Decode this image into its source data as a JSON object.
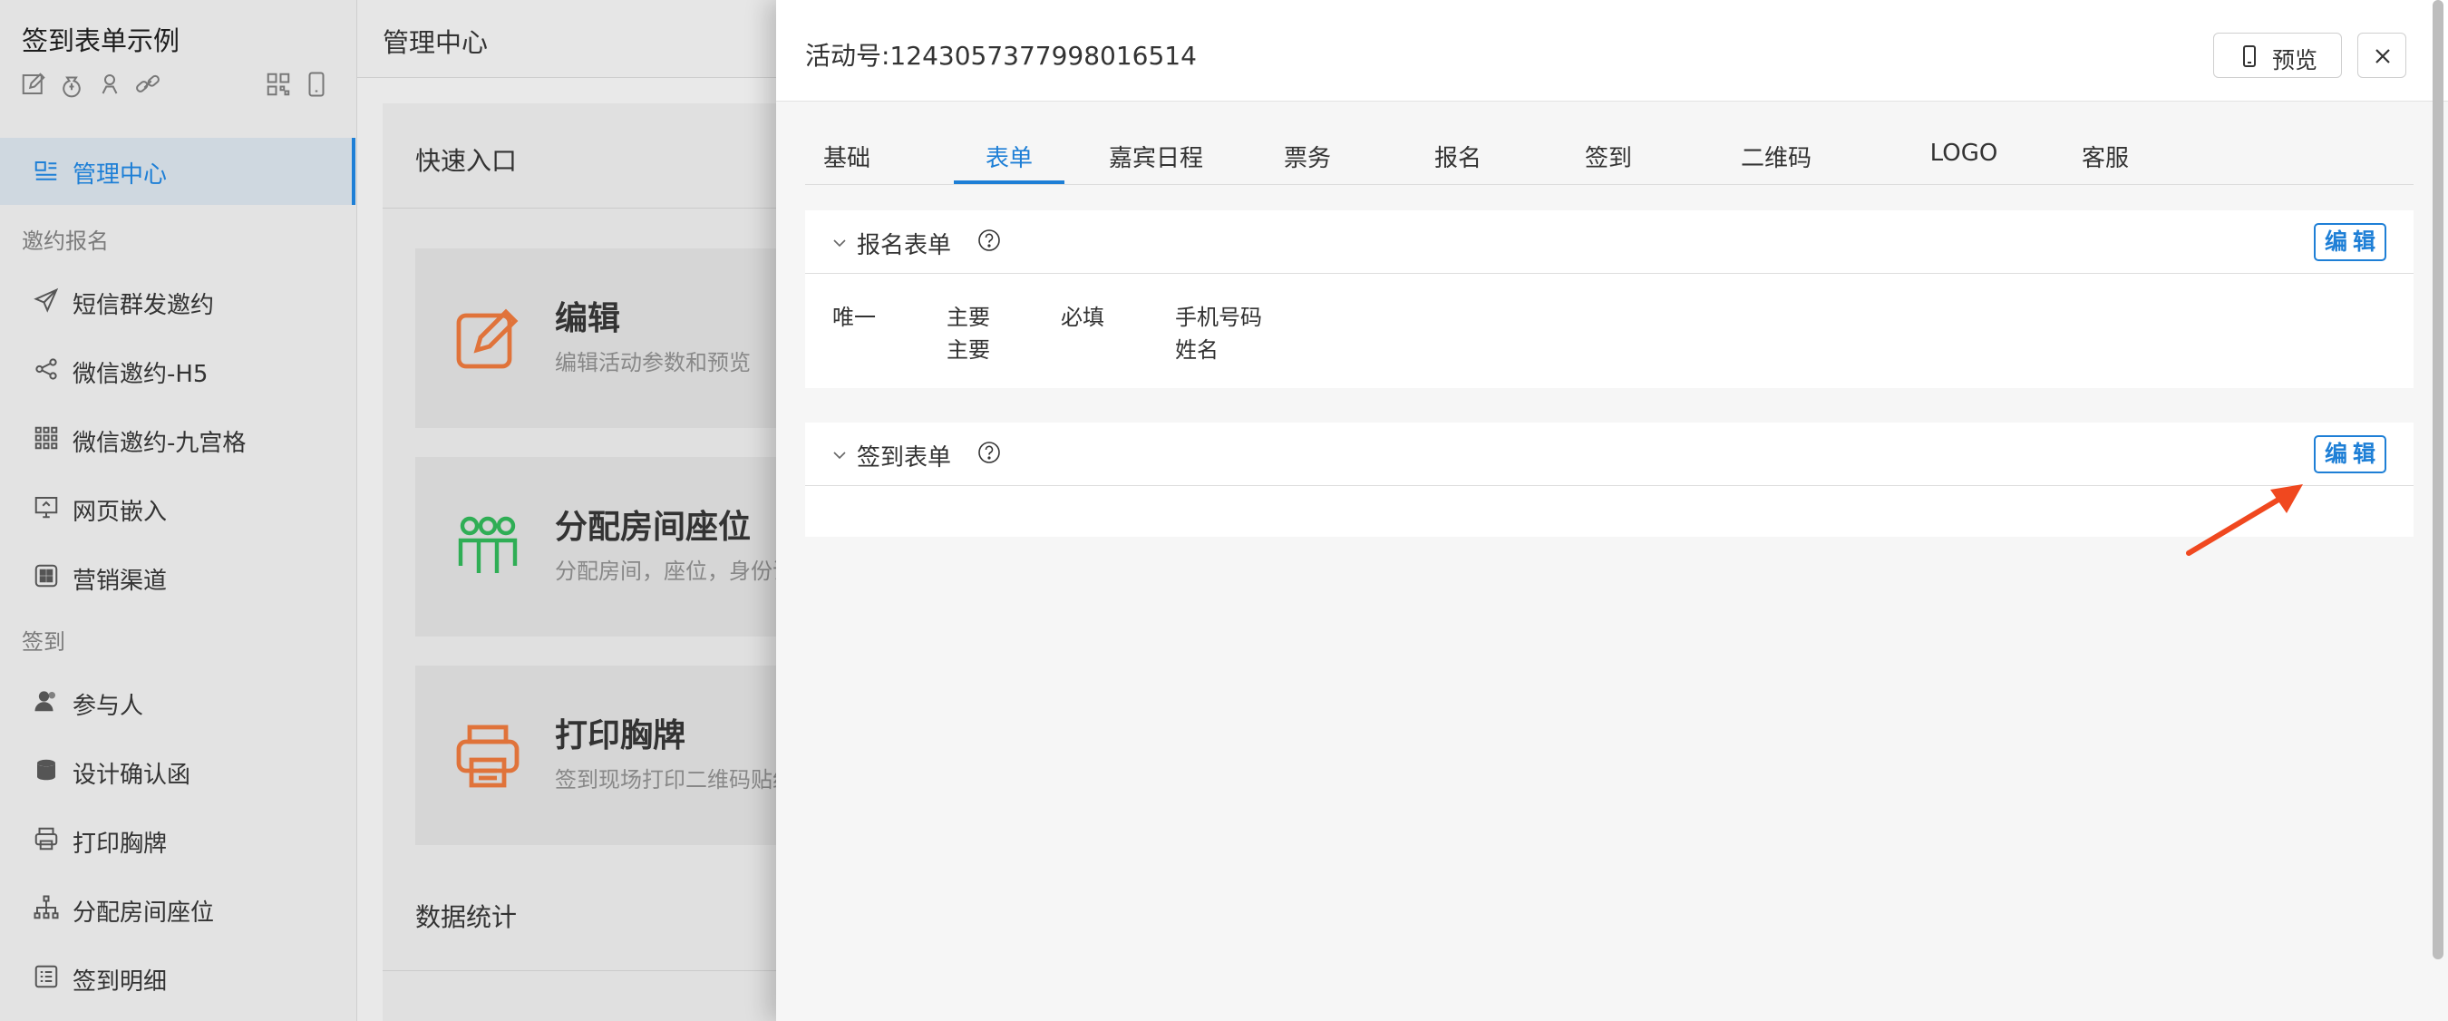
{
  "sidebar": {
    "app_title": "签到表单示例",
    "tool_icons": [
      "edit-icon",
      "money-bag-icon",
      "person-icon",
      "link-icon",
      "qrcode-icon",
      "mobile-icon"
    ],
    "active_item": {
      "label": "管理中心",
      "icon": "dashboard-icon"
    },
    "groups": [
      {
        "label": "邀约报名",
        "items": [
          {
            "label": "短信群发邀约",
            "icon": "send-icon"
          },
          {
            "label": "微信邀约-H5",
            "icon": "share-icon"
          },
          {
            "label": "微信邀约-九宫格",
            "icon": "grid-icon"
          },
          {
            "label": "网页嵌入",
            "icon": "monitor-icon"
          },
          {
            "label": "营销渠道",
            "icon": "apps-icon"
          }
        ]
      },
      {
        "label": "签到",
        "items": [
          {
            "label": "参与人",
            "icon": "users-icon"
          },
          {
            "label": "设计确认函",
            "icon": "database-icon"
          },
          {
            "label": "打印胸牌",
            "icon": "printer-icon"
          },
          {
            "label": "分配房间座位",
            "icon": "org-chart-icon"
          },
          {
            "label": "签到明细",
            "icon": "list-icon"
          }
        ]
      }
    ]
  },
  "main": {
    "header_title": "管理中心",
    "quick_entry_title": "快速入口",
    "cards": [
      {
        "title": "编辑",
        "desc": "编辑活动参数和预览",
        "icon": "edit-icon",
        "color": "#e0733a"
      },
      {
        "title": "分配房间座位",
        "desc": "分配房间，座位，身份证",
        "icon": "team-icon",
        "color": "#2fae55"
      },
      {
        "title": "打印胸牌",
        "desc": "签到现场打印二维码贴纸",
        "icon": "printer-icon",
        "color": "#e0733a"
      }
    ],
    "stats_title": "数据统计"
  },
  "drawer": {
    "title": "活动号:1243057377998016514",
    "preview_label": "预览",
    "tabs": [
      "基础",
      "表单",
      "嘉宾日程",
      "票务",
      "报名",
      "签到",
      "二维码",
      "LOGO",
      "客服"
    ],
    "active_tab": "表单",
    "sections": [
      {
        "title": "报名表单",
        "edit_label": "编辑",
        "columns": [
          {
            "lines": [
              "唯一"
            ]
          },
          {
            "lines": [
              "主要",
              "主要"
            ]
          },
          {
            "lines": [
              "必填"
            ]
          },
          {
            "lines": [
              "手机号码",
              "姓名"
            ]
          }
        ]
      },
      {
        "title": "签到表单",
        "edit_label": "编辑",
        "columns": []
      }
    ]
  },
  "colors": {
    "accent": "#1e7fd6",
    "arrow": "#f0481f",
    "card_orange": "#e0733a",
    "card_green": "#2fae55"
  }
}
